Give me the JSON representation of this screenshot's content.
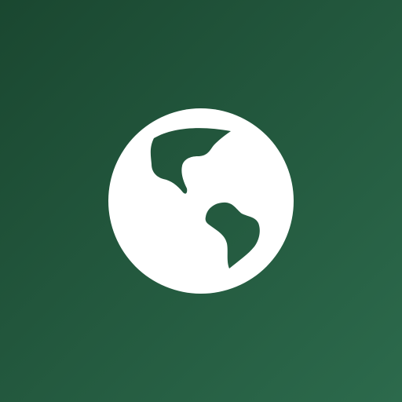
{
  "icon": {
    "name": "globe-icon",
    "background_gradient": [
      "#1a4730",
      "#2c6a4c"
    ],
    "foreground_color": "#ffffff"
  }
}
